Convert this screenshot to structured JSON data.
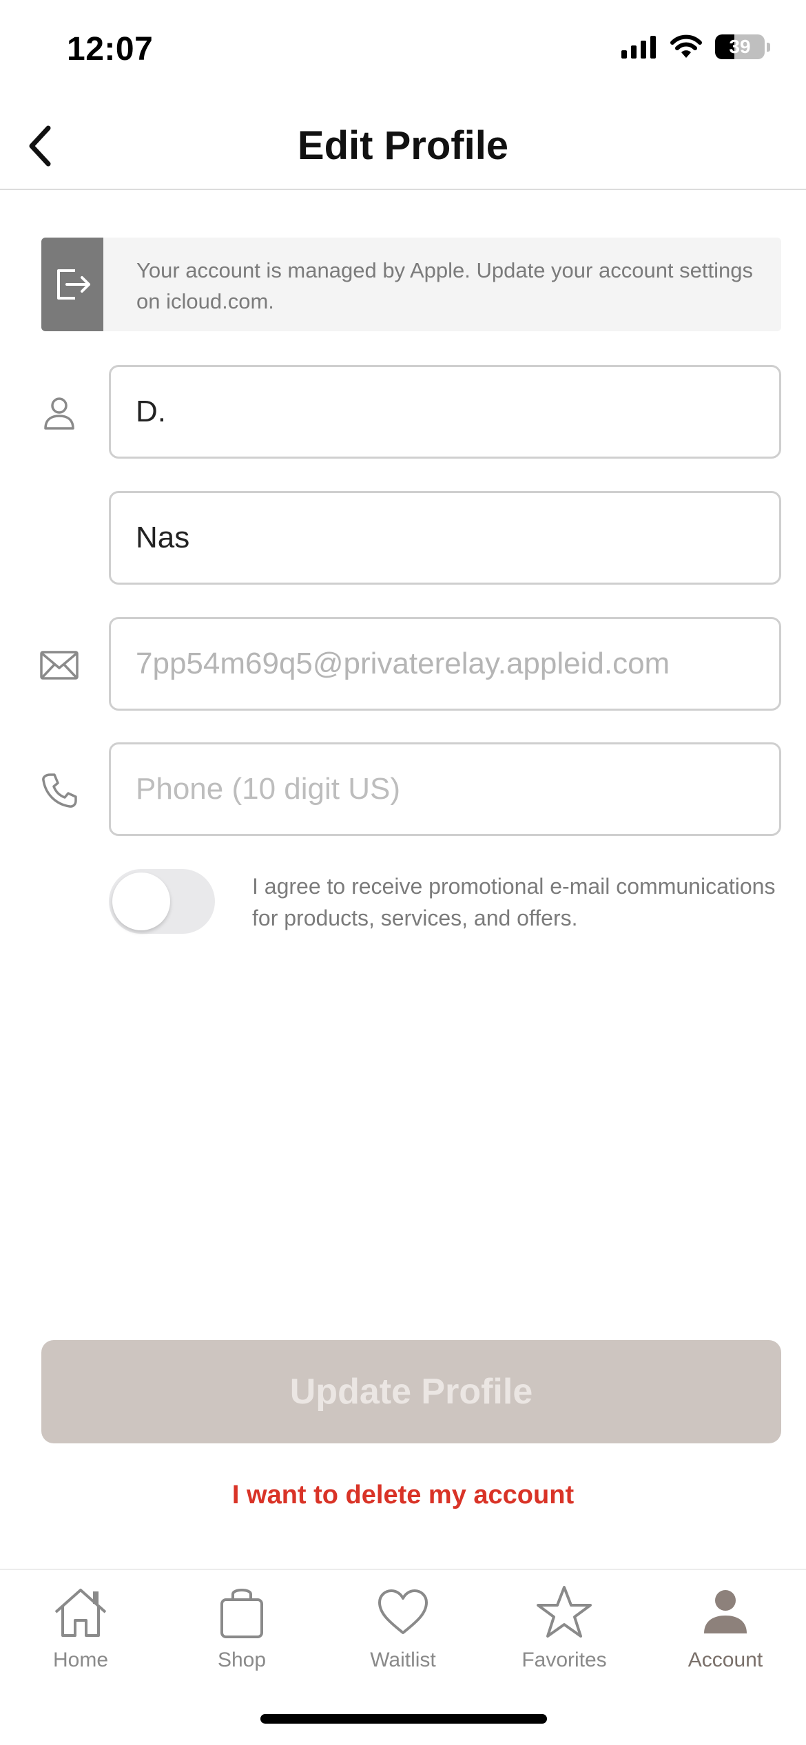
{
  "status_bar": {
    "time": "12:07",
    "battery_level": "39",
    "battery_fraction": 0.39,
    "icons": [
      "cellular-signal-icon",
      "wifi-icon",
      "battery-icon"
    ]
  },
  "header": {
    "title": "Edit Profile",
    "back_icon": "chevron-left-icon"
  },
  "info_banner": {
    "icon": "sign-out-icon",
    "text": "Your account is managed by Apple. Update your account settings on icloud.com."
  },
  "form": {
    "first_name": {
      "value": "D.",
      "icon": "person-icon"
    },
    "last_name": {
      "value": "Nas"
    },
    "email": {
      "value": "7pp54m69q5@privaterelay.appleid.com",
      "icon": "envelope-icon"
    },
    "phone": {
      "value": "",
      "placeholder": "Phone (10 digit US)",
      "icon": "phone-icon"
    },
    "promo_consent": {
      "enabled": false,
      "text": "I agree to receive promotional e-mail communications for products, services, and offers."
    }
  },
  "actions": {
    "update_label": "Update Profile",
    "delete_label": "I want to delete my account"
  },
  "tab_bar": {
    "tabs": [
      {
        "label": "Home",
        "icon": "home-icon",
        "active": false
      },
      {
        "label": "Shop",
        "icon": "shopping-bag-icon",
        "active": false
      },
      {
        "label": "Waitlist",
        "icon": "heart-icon",
        "active": false
      },
      {
        "label": "Favorites",
        "icon": "star-icon",
        "active": false
      },
      {
        "label": "Account",
        "icon": "person-filled-icon",
        "active": true
      }
    ]
  },
  "colors": {
    "accent_disabled_button": "#cdc5c0",
    "delete_red": "#d93327",
    "active_tab": "#8d817b",
    "banner_badge": "#7a7a7a"
  }
}
